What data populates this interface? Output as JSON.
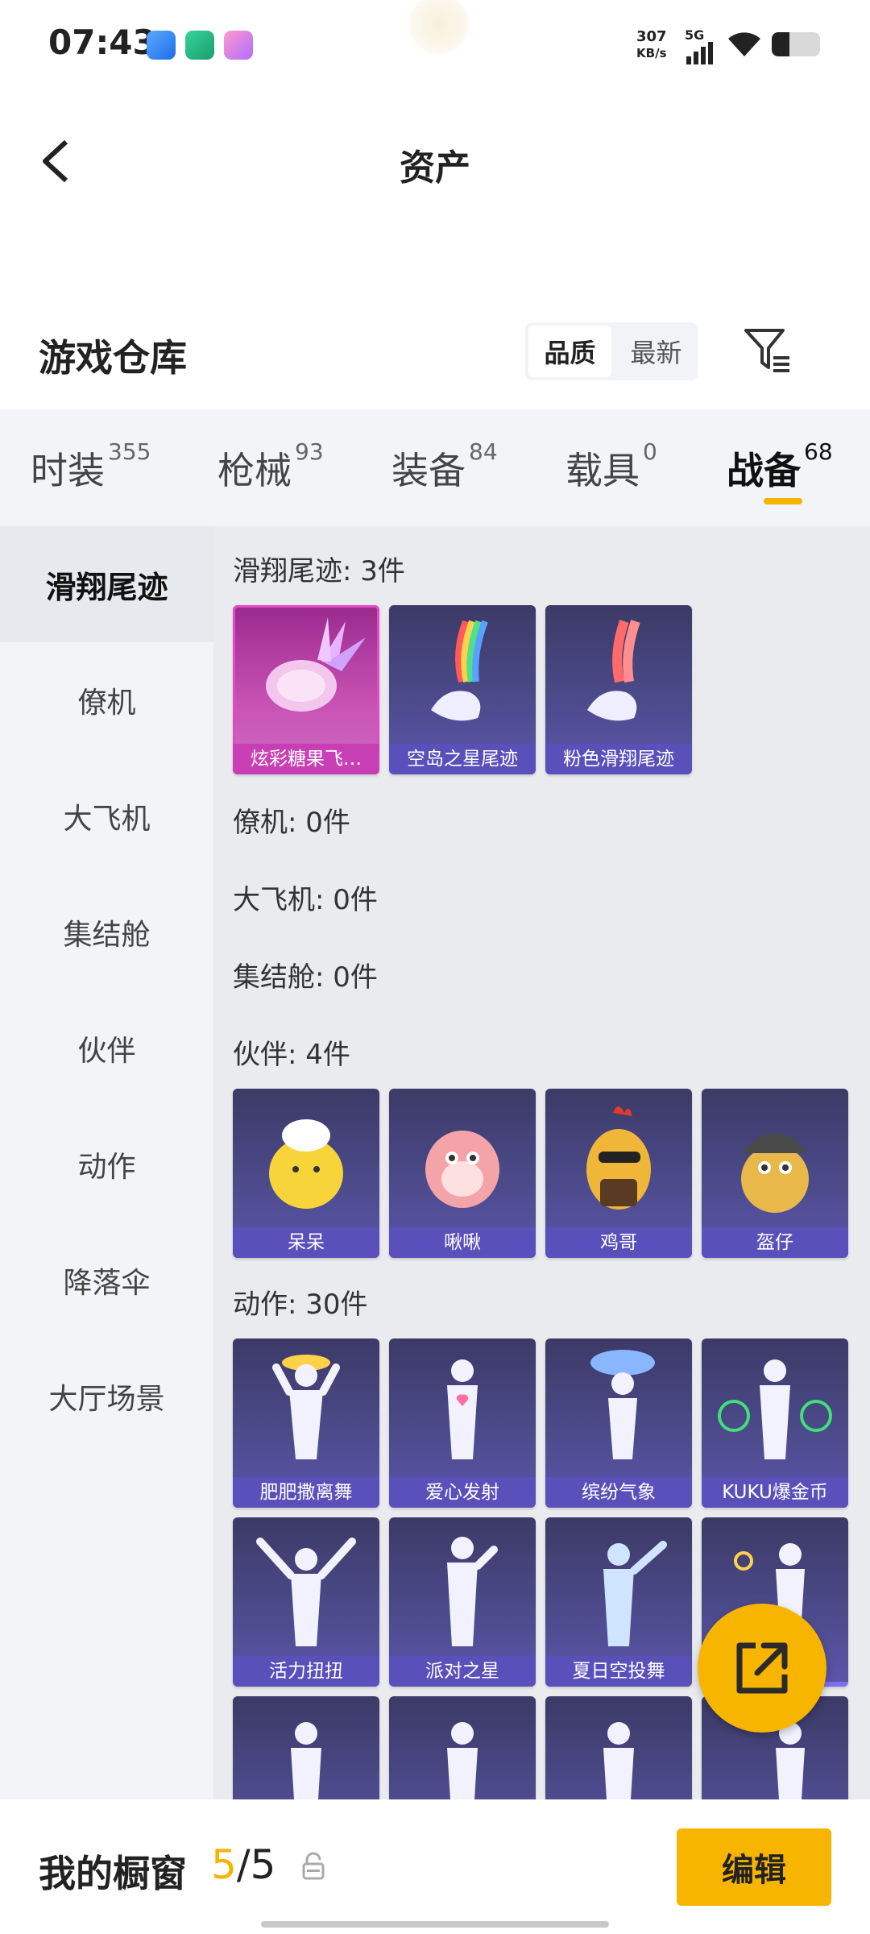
{
  "status_bar": {
    "time": "07:43",
    "net_speed": "307",
    "net_unit": "KB/s",
    "network": "5G"
  },
  "header": {
    "title": "资产"
  },
  "warehouse": {
    "title": "游戏仓库",
    "sort_options": [
      "品质",
      "最新"
    ],
    "active_sort": "品质"
  },
  "tabs": [
    {
      "label": "时装",
      "count": "355"
    },
    {
      "label": "枪械",
      "count": "93"
    },
    {
      "label": "装备",
      "count": "84"
    },
    {
      "label": "载具",
      "count": "0"
    },
    {
      "label": "战备",
      "count": "68",
      "active": true
    }
  ],
  "sidebar": [
    "滑翔尾迹",
    "僚机",
    "大飞机",
    "集结舱",
    "伙伴",
    "动作",
    "降落伞",
    "大厅场景"
  ],
  "sections": {
    "trail": {
      "title": "滑翔尾迹: 3件",
      "items": [
        "炫彩糖果飞…",
        "空岛之星尾迹",
        "粉色滑翔尾迹"
      ]
    },
    "wingman": {
      "title": "僚机: 0件"
    },
    "plane": {
      "title": "大飞机: 0件"
    },
    "pod": {
      "title": "集结舱: 0件"
    },
    "partner": {
      "title": "伙伴: 4件",
      "items": [
        "呆呆",
        "啾啾",
        "鸡哥",
        "盔仔"
      ]
    },
    "emote": {
      "title": "动作: 30件",
      "items": [
        "肥肥撒离舞",
        "爱心发射",
        "缤纷气象",
        "KUKU爆金币",
        "活力扭扭",
        "派对之星",
        "夏日空投舞"
      ]
    }
  },
  "bottom": {
    "showcase_label": "我的橱窗",
    "count_current": "5",
    "count_sep": "/",
    "count_total": "5",
    "edit_label": "编辑"
  },
  "colors": {
    "accent": "#f7b500",
    "card": "#4c4a8a",
    "card_pink": "#c953b5"
  }
}
